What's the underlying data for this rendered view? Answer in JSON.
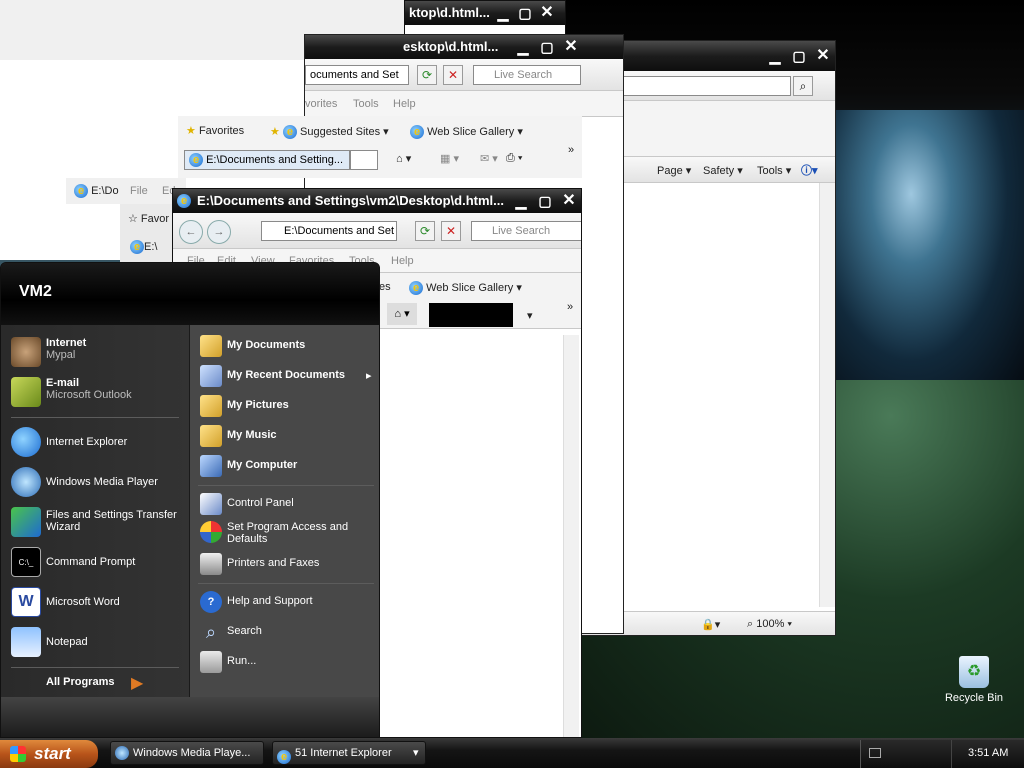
{
  "colors": {
    "titlebar": "#1c1c1c",
    "start_button": "#b8541a",
    "menu_bg": "#2d2d2d"
  },
  "back_window_a": {
    "title": "ktop\\d.html..."
  },
  "window_b": {
    "title": "esktop\\d.html...",
    "address": "ocuments and Set",
    "search_placeholder": "Live Search",
    "menu": [
      "vorites",
      "Tools",
      "Help"
    ],
    "favorites": "Favorites",
    "suggested": "Suggested Sites",
    "webslice": "Web Slice Gallery",
    "tab_title": "E:\\Documents and Setting..."
  },
  "window_c": {
    "page_menu": "Page",
    "safety_menu": "Safety",
    "tools_menu": "Tools",
    "zoom": "100%"
  },
  "window_d": {
    "title": "E:\\Documents and Settings\\vm2\\Desktop\\d.html...",
    "address": "E:\\Documents and Set",
    "search_placeholder": "Live Search",
    "menu": [
      "File",
      "Edit",
      "View",
      "Favorites",
      "Tools",
      "Help"
    ],
    "webslice": "Web Slice Gallery",
    "favorites_partial": "es"
  },
  "bg_fragments": {
    "tab_partial": "E:\\Do",
    "favor_partial": "Favor",
    "file_partial": "File",
    "edit_partial": "Ed",
    "tab2_partial": "E:\\"
  },
  "start_menu": {
    "user": "VM2",
    "pinned": [
      {
        "title": "Internet",
        "sub": "Mypal"
      },
      {
        "title": "E-mail",
        "sub": "Microsoft Outlook"
      }
    ],
    "recent": [
      "Internet Explorer",
      "Windows Media Player",
      "Files and Settings Transfer Wizard",
      "Command Prompt",
      "Microsoft Word",
      "Notepad"
    ],
    "all_programs": "All Programs",
    "right_bold": [
      "My Documents",
      "My Recent Documents",
      "My Pictures",
      "My Music",
      "My Computer"
    ],
    "right_mid": [
      "Control Panel",
      "Set Program Access and Defaults",
      "Printers and Faxes"
    ],
    "right_low": [
      "Help and Support",
      "Search",
      "Run..."
    ]
  },
  "taskbar": {
    "start": "start",
    "wmp": "Windows Media Playe...",
    "ie": "51 Internet Explorer",
    "clock": "3:51 AM"
  },
  "desktop": {
    "recycle_bin": "Recycle Bin"
  }
}
